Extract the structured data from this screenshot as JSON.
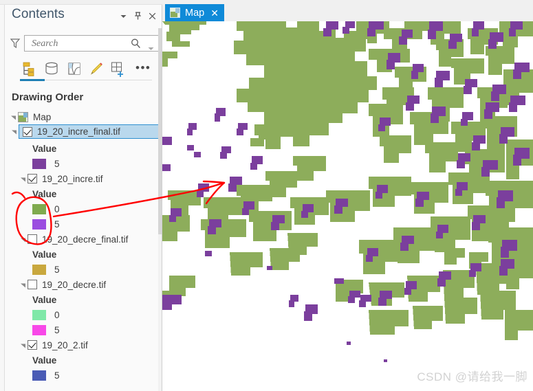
{
  "pane": {
    "title": "Contents",
    "header_buttons": [
      {
        "name": "menu-dropdown",
        "glyph": "▾"
      },
      {
        "name": "pin",
        "glyph": "📌"
      },
      {
        "name": "close",
        "glyph": "✕"
      }
    ],
    "search": {
      "placeholder": "Search",
      "value": "",
      "filter_icon": "funnel-icon",
      "go_icon": "magnifier-icon",
      "dropdown_icon": "chevron-down-icon"
    },
    "toolbar": {
      "icons": [
        "list-by-drawing-order-icon",
        "list-by-data-source-icon",
        "list-by-selection-icon",
        "list-by-editing-icon",
        "list-by-snapping-icon"
      ],
      "more_label": "•••"
    },
    "drawing_order_label": "Drawing Order",
    "scrollbar": "vertical-scrollbar"
  },
  "tree": {
    "root": {
      "label": "Map",
      "icon": "map-icon",
      "expanded": true
    },
    "layers": [
      {
        "name": "19_20_incre_final.tif",
        "checked": true,
        "selected": true,
        "expanded": true,
        "legend_title": "Value",
        "classes": [
          {
            "value": "5",
            "color": "#7B3F9D"
          }
        ]
      },
      {
        "name": "19_20_incre.tif",
        "checked": true,
        "selected": false,
        "expanded": true,
        "legend_title": "Value",
        "classes": [
          {
            "value": "0",
            "color": "#7FAA4E"
          },
          {
            "value": "5",
            "color": "#9B4DE0"
          }
        ]
      },
      {
        "name": "19_20_decre_final.tif",
        "checked": false,
        "selected": false,
        "expanded": true,
        "legend_title": "Value",
        "classes": [
          {
            "value": "5",
            "color": "#C9A83E"
          }
        ]
      },
      {
        "name": "19_20_decre.tif",
        "checked": false,
        "selected": false,
        "expanded": true,
        "legend_title": "Value",
        "classes": [
          {
            "value": "0",
            "color": "#7FE8A8"
          },
          {
            "value": "5",
            "color": "#F848E8"
          }
        ]
      },
      {
        "name": "19_20_2.tif",
        "checked": true,
        "selected": false,
        "expanded": true,
        "legend_title": "Value",
        "classes": [
          {
            "value": "5",
            "color": "#4A5BB5"
          }
        ]
      }
    ]
  },
  "map_view": {
    "tab_label": "Map",
    "tab_close_glyph": "✕",
    "tab_icon": "map-thumbnail-icon",
    "tab_active_color": "#0F8AD8",
    "raster_green": "#8DAD5B",
    "raster_purple": "#7B3F9D",
    "background": "#FFFFFF",
    "annotation": {
      "color": "#FF0000",
      "shapes": [
        "hand-drawn-ellipse",
        "hand-drawn-arrow"
      ]
    }
  },
  "watermark": {
    "text": "CSDN @请给我一脚"
  }
}
